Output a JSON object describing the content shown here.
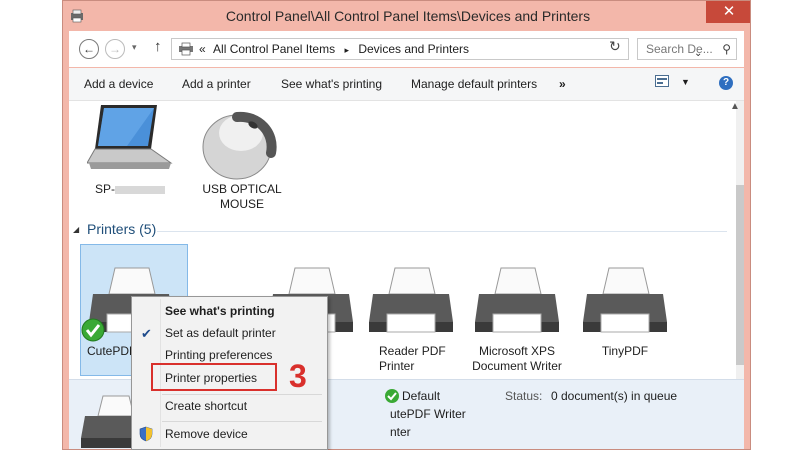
{
  "window": {
    "title": "Control Panel\\All Control Panel Items\\Devices and Printers",
    "close_glyph": "✕"
  },
  "address": {
    "breadcrumb_prefix": "«",
    "crumbs": [
      "All Control Panel Items",
      "Devices and Printers"
    ],
    "separator": "▸",
    "search_placeholder": "Search De..."
  },
  "commands": {
    "add_device": "Add a device",
    "add_printer": "Add a printer",
    "see_printing": "See what's printing",
    "manage_default": "Manage default printers",
    "more": "»"
  },
  "devices": {
    "computer_label": "SP-",
    "mouse_label_1": "USB OPTICAL",
    "mouse_label_2": "MOUSE"
  },
  "printers": {
    "section_title": "Printers (5)",
    "items": [
      {
        "label_1": "CutePDF",
        "label_2": ""
      },
      {
        "label_1": "",
        "label_2": ""
      },
      {
        "label_1": "Reader PDF",
        "label_2": "Printer"
      },
      {
        "label_1": "Microsoft XPS",
        "label_2": "Document Writer"
      },
      {
        "label_1": "TinyPDF",
        "label_2": ""
      }
    ]
  },
  "details": {
    "default_label": "Default",
    "name_line": "utePDF Writer",
    "type_line": "nter",
    "status_label": "Status:",
    "status_value": "0 document(s) in queue"
  },
  "context_menu": {
    "items": [
      "See what's printing",
      "Set as default printer",
      "Printing preferences",
      "Printer properties",
      "Create shortcut",
      "Remove device"
    ]
  },
  "annotation": {
    "step_number": "3",
    "highlight_color": "#d9302c"
  },
  "colors": {
    "titlebar": "#f3b7aa",
    "close_button": "#c7493a",
    "section_heading": "#1f4e79",
    "details_pane": "#e9f0f8",
    "selection": "#cce4f7"
  }
}
